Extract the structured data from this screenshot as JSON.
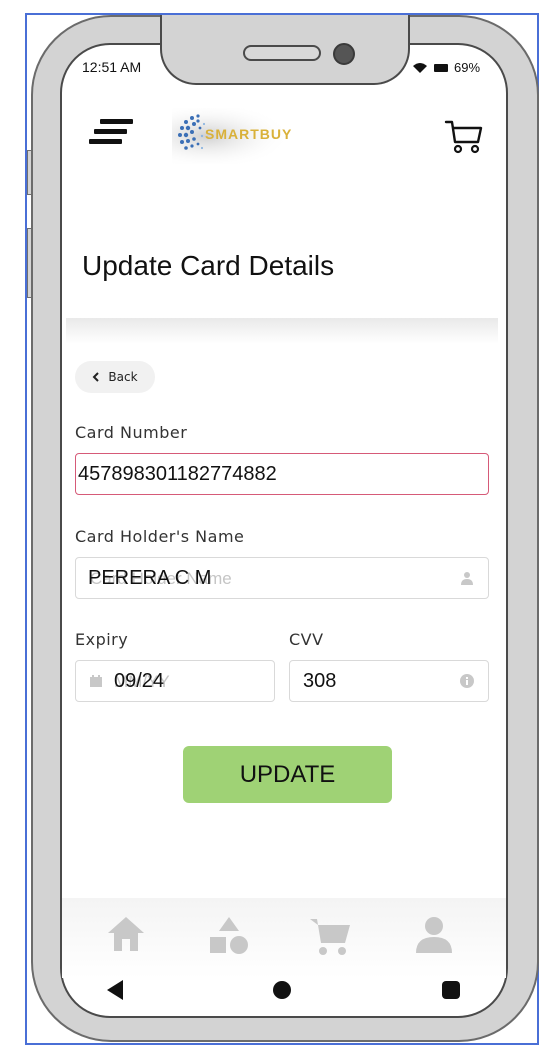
{
  "status_bar": {
    "time": "12:51 AM",
    "battery": "69%"
  },
  "header": {
    "brand": "SMARTBUY",
    "icons": [
      "menu-icon",
      "cart-icon"
    ]
  },
  "page": {
    "title": "Update Card Details"
  },
  "back_button": {
    "label": "Back",
    "icon": "chevron-left-icon"
  },
  "form": {
    "card_number": {
      "label": "Card Number",
      "value": "457898301182774882"
    },
    "card_holder": {
      "label": "Card Holder's Name",
      "placeholder": "Card Holder Name",
      "value": "PERERA C M",
      "icon": "user-icon"
    },
    "expiry": {
      "label": "Expiry",
      "placeholder": "MM/YY",
      "value": "09/24",
      "icon": "calendar-icon"
    },
    "cvv": {
      "label": "CVV",
      "value": "308",
      "icon": "info-icon"
    }
  },
  "update_button": {
    "label": "UPDATE",
    "color": "#9fd275"
  },
  "bottom_nav": {
    "icons": [
      "home-icon",
      "categories-icon",
      "cart-icon",
      "profile-icon"
    ]
  },
  "system_nav": {
    "icons": [
      "back-triangle-icon",
      "home-circle-icon",
      "recents-square-icon"
    ]
  },
  "colors": {
    "error_border": "#d65a78",
    "frame_border": "#4a6fd6",
    "icon_gray": "#c8c8c8"
  }
}
